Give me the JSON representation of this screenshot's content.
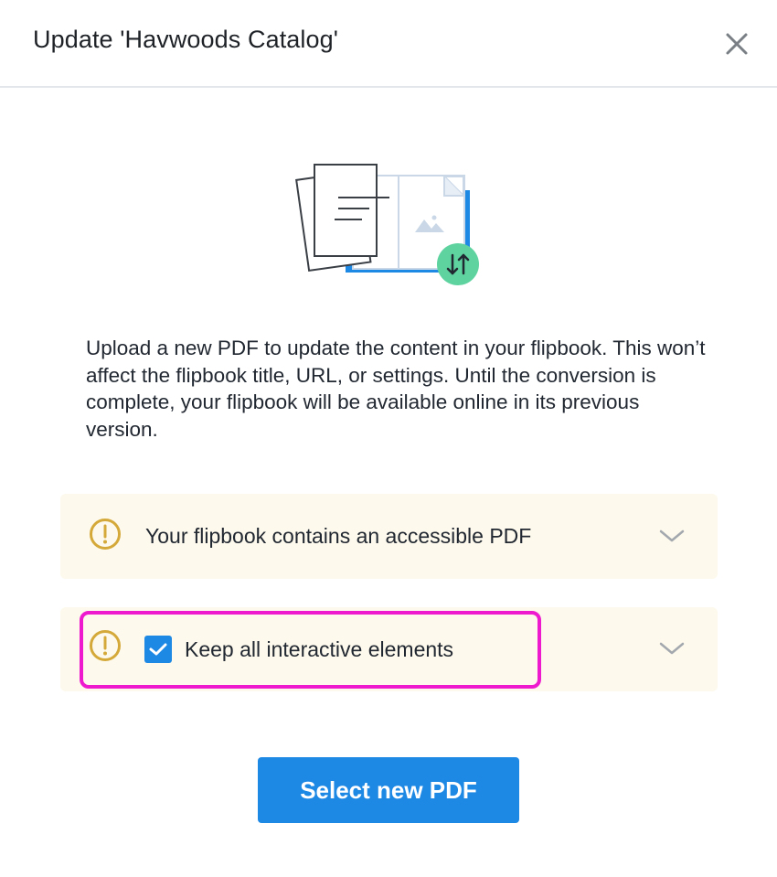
{
  "dialog": {
    "title": "Update 'Havwoods Catalog'",
    "close_icon": "close-icon"
  },
  "illustration": {
    "icon": "pdf-update-illustration",
    "badge_icon": "swap-vertical-arrows-icon"
  },
  "description": "Upload a new PDF to update the content in your flipbook. This won’t affect the flipbook title, URL, or settings. Until the conversion is complete, your flipbook will be available online in its previous version.",
  "notices": [
    {
      "icon": "warning-icon",
      "text": "Your flipbook contains an accessible PDF",
      "expand_icon": "chevron-down-icon"
    },
    {
      "icon": "warning-icon",
      "checkbox_checked": true,
      "checkbox_label": "Keep all interactive elements",
      "expand_icon": "chevron-down-icon"
    }
  ],
  "primary_button": {
    "label": "Select new PDF"
  },
  "colors": {
    "accent": "#1e88e5",
    "warning": "#d4a93a",
    "notice_bg": "#fdf9ec",
    "highlight": "#ee1bce",
    "badge_green": "#5ed3a0"
  }
}
